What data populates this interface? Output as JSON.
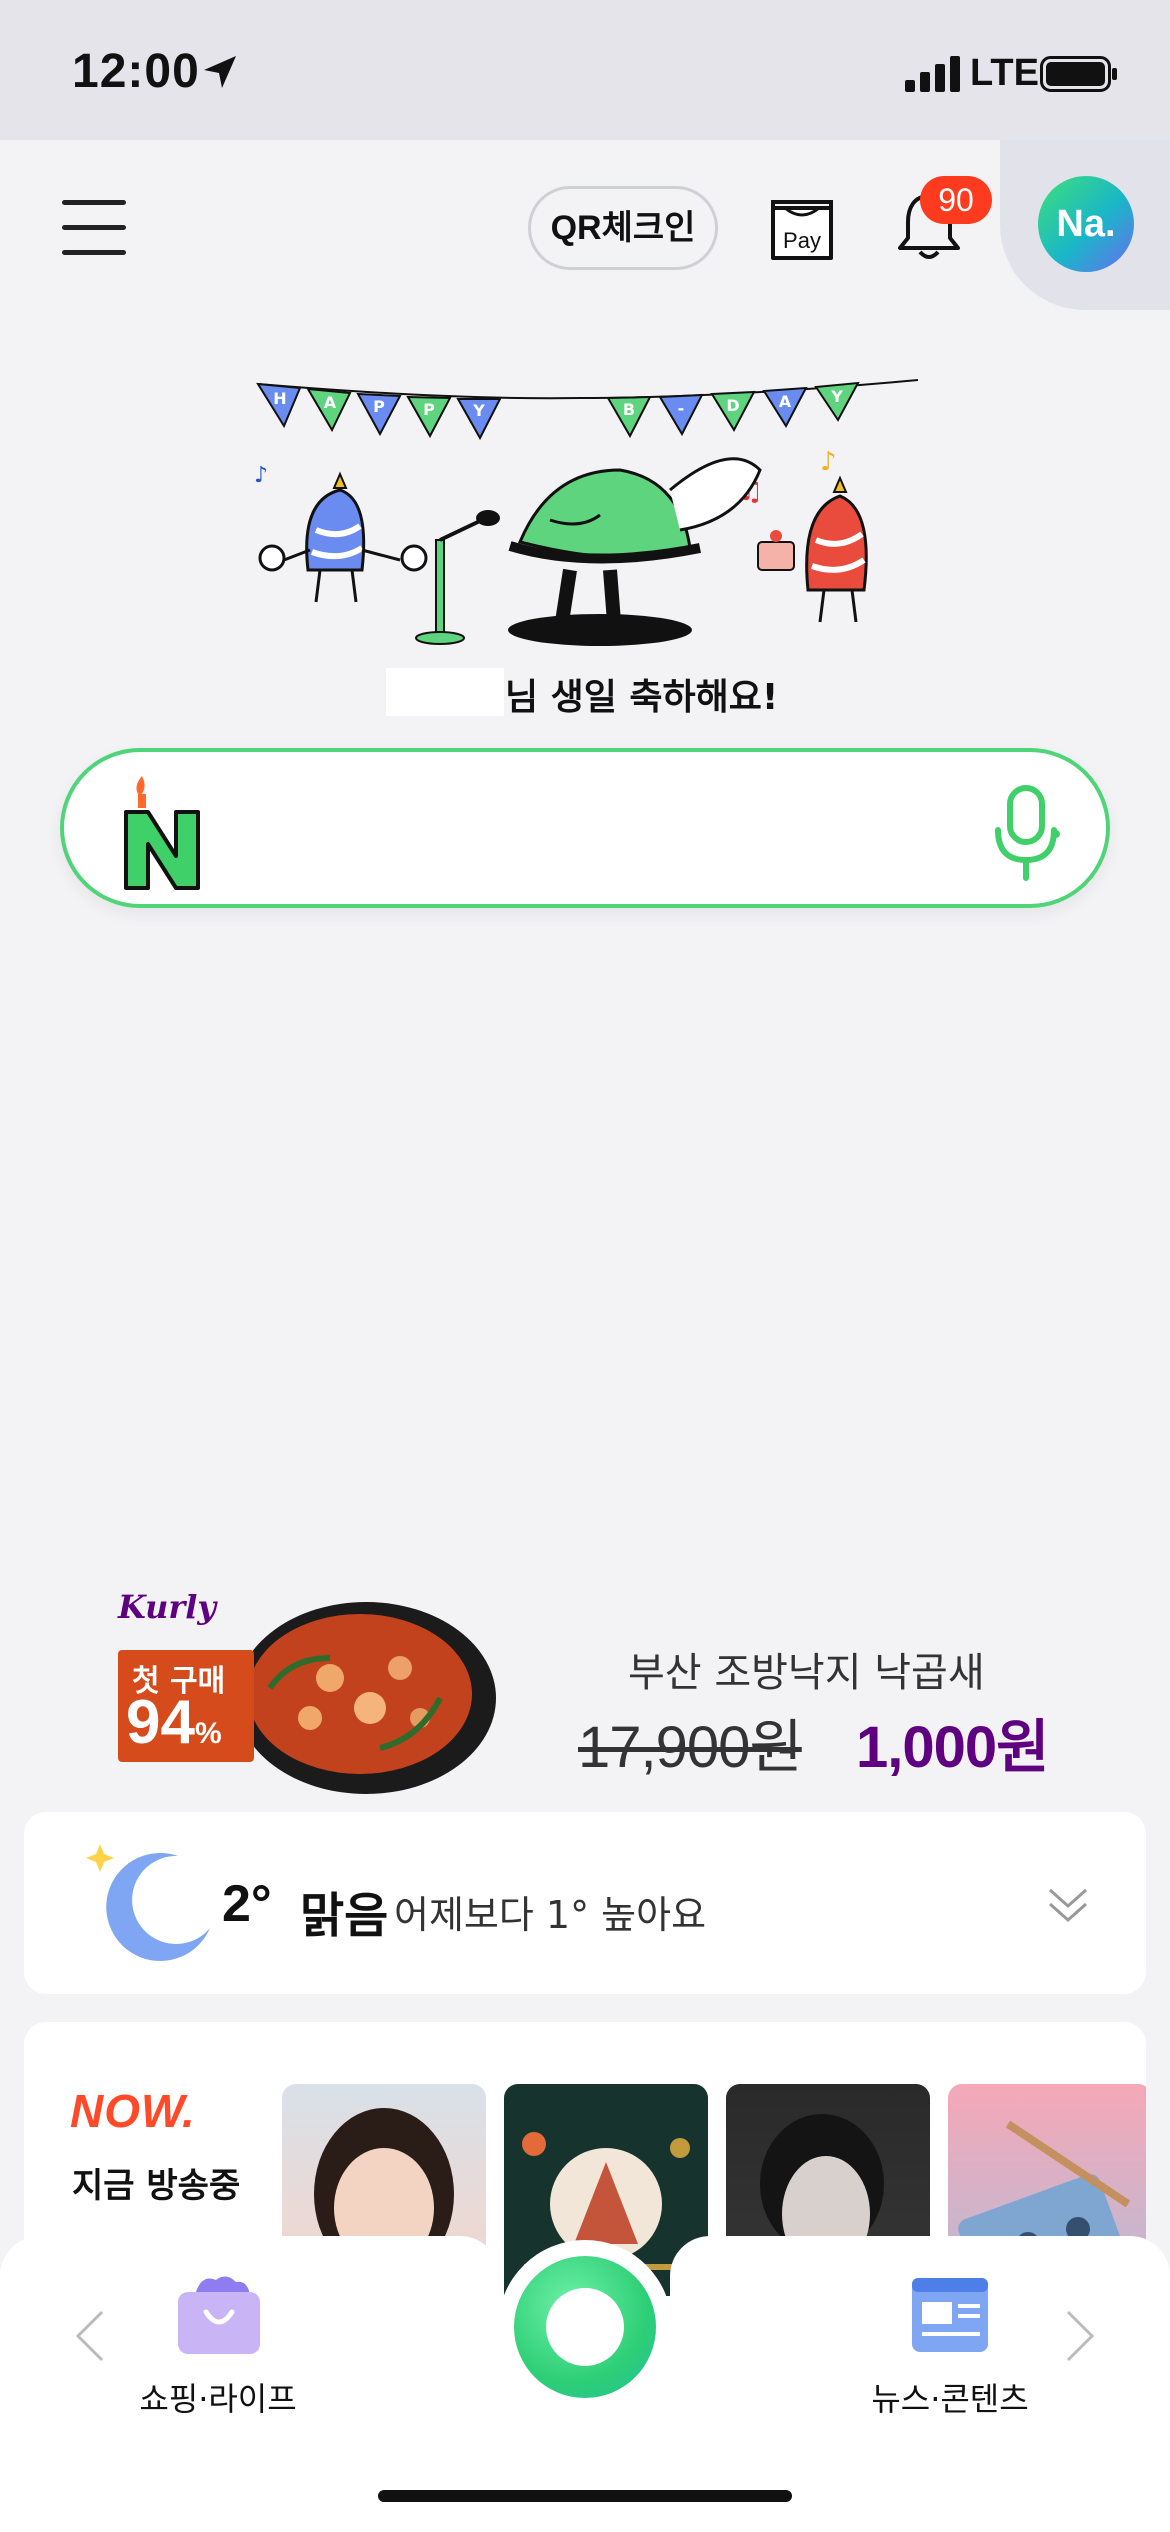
{
  "status_bar": {
    "time": "12:00",
    "network": "LTE"
  },
  "header": {
    "qr_label": "QR체크인",
    "pay_label": "Pay",
    "notification_count": "90",
    "avatar_text": "Na."
  },
  "birthday": {
    "banner_letters": [
      "H",
      "A",
      "P",
      "P",
      "Y",
      "B",
      "-",
      "D",
      "A",
      "Y"
    ],
    "message": "님 생일 축하해요!"
  },
  "search": {
    "logo_letter": "N",
    "placeholder": ""
  },
  "ad": {
    "brand": "Kurly",
    "badge_line1": "첫 구매",
    "badge_line2": "94",
    "badge_percent": "%",
    "title": "부산 조방낙지 낙곱새",
    "old_price": "17,900원",
    "new_price": "1,000원"
  },
  "weather": {
    "temp": "2°",
    "sky": "맑음",
    "compare": "어제보다 1° 높아요",
    "icon": "moon-icon"
  },
  "now": {
    "logo": "NOW.",
    "subtitle": "지금 방송중"
  },
  "bottom_nav": {
    "left_label": "쇼핑·라이프",
    "right_label": "뉴스·콘텐츠"
  },
  "colors": {
    "accent_green": "#4fd478",
    "badge_red": "#ff3b1f",
    "kurly_purple": "#5f0080"
  }
}
